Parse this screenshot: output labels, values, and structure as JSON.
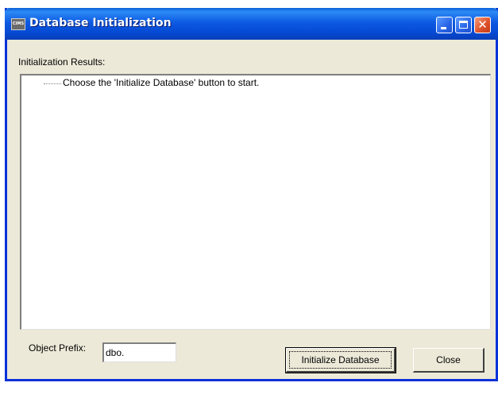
{
  "window": {
    "title": "Database Initialization",
    "app_icon_text": "CIMS",
    "title_color": "#0a5fd8",
    "window_bg": "#ece9d8"
  },
  "results": {
    "label": "Initialization Results:",
    "items": [
      "Choose the 'Initialize Database' button to start."
    ]
  },
  "prefix": {
    "label": "Object Prefix:",
    "value": "dbo."
  },
  "buttons": {
    "initialize_label": "Initialize Database",
    "close_label": "Close"
  },
  "caption_buttons": {
    "minimize_icon": "minimize-icon",
    "maximize_icon": "maximize-icon",
    "close_icon": "close-icon"
  }
}
